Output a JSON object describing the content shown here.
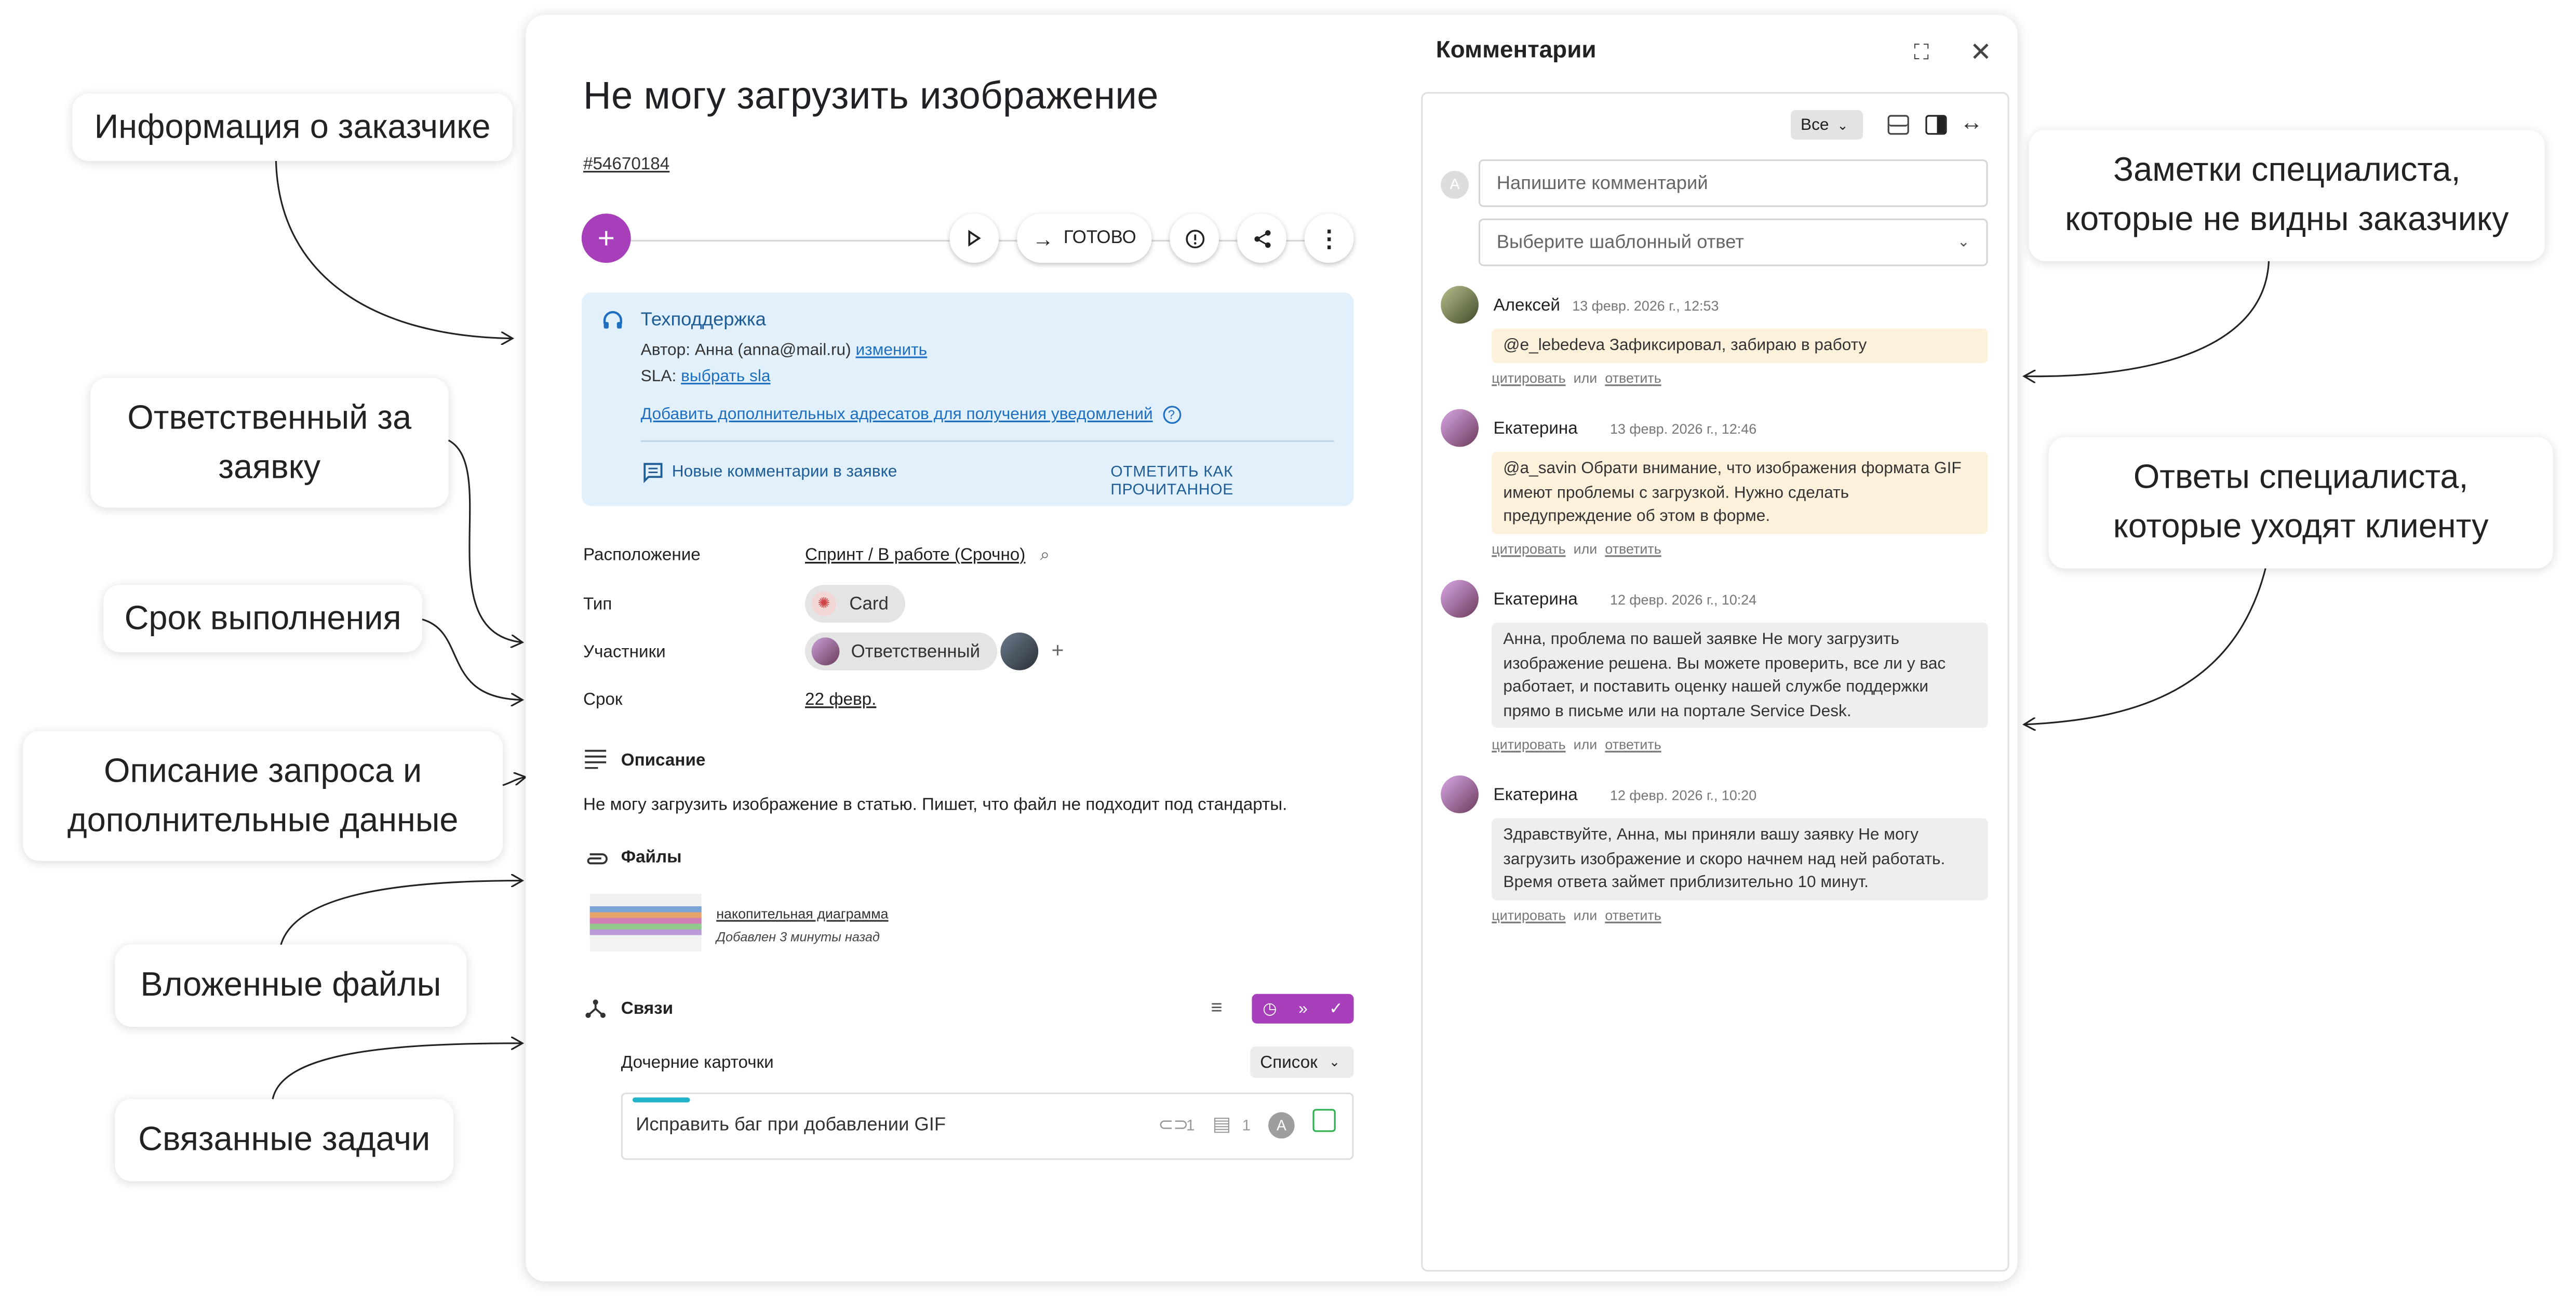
{
  "callouts": {
    "customer_info": "Информация о заказчике",
    "responsible": "Ответственный за заявку",
    "deadline": "Срок выполнения",
    "description": "Описание запроса и дополнительные данные",
    "attachments": "Вложенные файлы",
    "related": "Связанные задачи",
    "notes": "Заметки специалиста, которые не видны заказчику",
    "replies": "Ответы специалиста, которые уходят клиенту"
  },
  "ticket": {
    "title": "Не могу загрузить изображение",
    "id": "#54670184",
    "status_button": "ГОТОВО",
    "info": {
      "queue": "Техподдержка",
      "author_label": "Автор: Анна (anna@mail.ru)",
      "change_link": "изменить",
      "sla_label": "SLA:",
      "sla_link": "выбрать sla",
      "add_recipients": "Добавить дополнительных адресатов для получения уведомлений",
      "new_comments": "Новые комментарии в заявке",
      "mark_read": "ОТМЕТИТЬ КАК ПРОЧИТАННОЕ"
    },
    "props": {
      "location_label": "Расположение",
      "location_value": "Спринт / В работе (Срочно)",
      "type_label": "Тип",
      "type_value": "Card",
      "members_label": "Участники",
      "members_value": "Ответственный",
      "deadline_label": "Срок",
      "deadline_value": "22 февр."
    },
    "description": {
      "heading": "Описание",
      "text": "Не могу загрузить изображение в статью. Пишет, что файл не подходит под стандарты."
    },
    "files": {
      "heading": "Файлы",
      "name": "накопительная диаграмма",
      "added": "Добавлен 3 минуты назад"
    },
    "links": {
      "heading": "Связи",
      "children_label": "Дочерние карточки",
      "view_select": "Список",
      "child_title": "Исправить баг при добавлении GIF",
      "child_attach_count": "1",
      "child_comment_count": "1",
      "child_avatar": "A"
    }
  },
  "comments_panel": {
    "title": "Комментарии",
    "filter": "Все",
    "input_placeholder": "Напишите комментарий",
    "template_placeholder": "Выберите шаблонный ответ",
    "self_avatar": "А",
    "quote": "цитировать",
    "or": "или",
    "reply": "ответить",
    "comments": [
      {
        "author": "Алексей",
        "date": "13 февр. 2026 г., 12:53",
        "text": "@e_lebedeva Зафиксировал, забираю в работу",
        "kind": "note"
      },
      {
        "author": "Екатерина",
        "date": "13 февр. 2026 г., 12:46",
        "text": "@a_savin Обрати внимание, что изображения формата GIF имеют проблемы с загрузкой. Нужно сделать предупреждение об этом в форме.",
        "kind": "note"
      },
      {
        "author": "Екатерина",
        "date": "12 февр. 2026 г., 10:24",
        "text": "Анна, проблема по вашей заявке Не могу загрузить изображение решена. Вы можете проверить, все ли у вас работает, и поставить оценку нашей службе поддержки прямо в письме или на портале Service Desk.",
        "kind": "reply"
      },
      {
        "author": "Екатерина",
        "date": "12 февр. 2026 г., 10:20",
        "text": "Здравствуйте, Анна, мы приняли вашу заявку Не могу загрузить изображение и скоро начнем над ней работать. Время ответа займет приблизительно 10 минут.",
        "kind": "reply"
      }
    ]
  },
  "colors": {
    "accent": "#a83fba",
    "info_bg": "#e2f0fb",
    "link": "#1e6fbf",
    "note_bg": "#fdf1dc",
    "reply_bg": "#eeeeee"
  }
}
